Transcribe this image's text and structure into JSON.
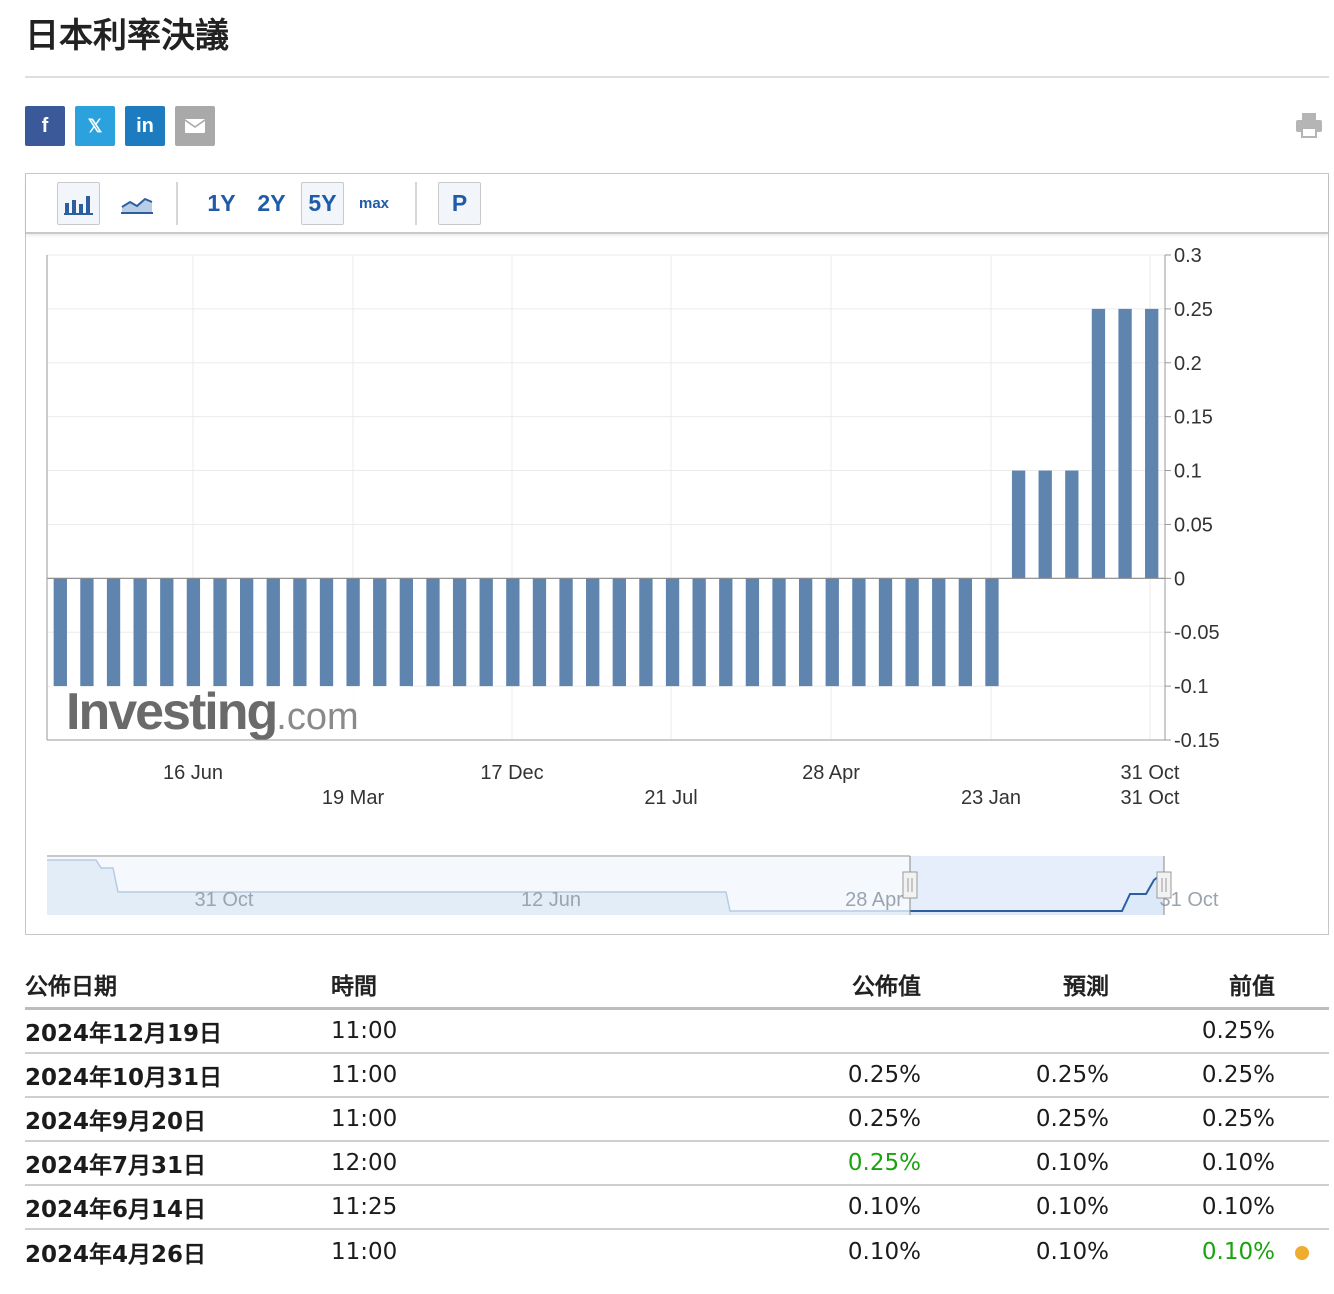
{
  "page": {
    "title": "日本利率決議"
  },
  "share": {
    "facebook": "f",
    "twitter": "𝕏",
    "linkedin": "in"
  },
  "colors": {
    "facebook": "#3b5998",
    "twitter": "#2ba2dd",
    "linkedin": "#1d7cbf",
    "email": "#a9a9a9",
    "bar": "#5f84ae",
    "accent_green": "#19a30f",
    "alert_dot": "#f0ac2e"
  },
  "toolbar": {
    "icons": [
      "bar-chart-icon",
      "area-chart-icon"
    ],
    "ranges": [
      "1Y",
      "2Y",
      "5Y",
      "max"
    ],
    "selected_range": "5Y",
    "p_label": "P"
  },
  "chart_data": {
    "type": "bar",
    "values": [
      -0.1,
      -0.1,
      -0.1,
      -0.1,
      -0.1,
      -0.1,
      -0.1,
      -0.1,
      -0.1,
      -0.1,
      -0.1,
      -0.1,
      -0.1,
      -0.1,
      -0.1,
      -0.1,
      -0.1,
      -0.1,
      -0.1,
      -0.1,
      -0.1,
      -0.1,
      -0.1,
      -0.1,
      -0.1,
      -0.1,
      -0.1,
      -0.1,
      -0.1,
      -0.1,
      -0.1,
      -0.1,
      -0.1,
      -0.1,
      -0.1,
      -0.1,
      0.1,
      0.1,
      0.1,
      0.25,
      0.25,
      0.25
    ],
    "ylim": [
      -0.15,
      0.3
    ],
    "y_ticks": [
      "0.3",
      "0.25",
      "0.2",
      "0.15",
      "0.1",
      "0.05",
      "0",
      "-0.05",
      "-0.1",
      "-0.15"
    ],
    "x_ticks_top": [
      "16 Jun",
      "17 Dec",
      "28 Apr",
      "31 Oct"
    ],
    "x_ticks_bottom": [
      "19 Mar",
      "21 Jul",
      "23 Jan",
      "31 Oct"
    ],
    "grid": true,
    "watermark": "Investing.com",
    "navigator_labels": [
      "31 Oct",
      "12 Jun",
      "28 Apr",
      "31 Oct"
    ]
  },
  "table": {
    "headers": {
      "date": "公佈日期",
      "time": "時間",
      "actual": "公佈值",
      "forecast": "預測",
      "previous": "前值"
    },
    "rows": [
      {
        "date": "2024年12月19日",
        "time": "11:00",
        "actual": "",
        "forecast": "",
        "previous": "0.25%"
      },
      {
        "date": "2024年10月31日",
        "time": "11:00",
        "actual": "0.25%",
        "forecast": "0.25%",
        "previous": "0.25%"
      },
      {
        "date": "2024年9月20日",
        "time": "11:00",
        "actual": "0.25%",
        "forecast": "0.25%",
        "previous": "0.25%"
      },
      {
        "date": "2024年7月31日",
        "time": "12:00",
        "actual": "0.25%",
        "forecast": "0.10%",
        "previous": "0.10%"
      },
      {
        "date": "2024年6月14日",
        "time": "11:25",
        "actual": "0.10%",
        "forecast": "0.10%",
        "previous": "0.10%"
      },
      {
        "date": "2024年4月26日",
        "time": "11:00",
        "actual": "0.10%",
        "forecast": "0.10%",
        "previous": "0.10%"
      }
    ]
  }
}
